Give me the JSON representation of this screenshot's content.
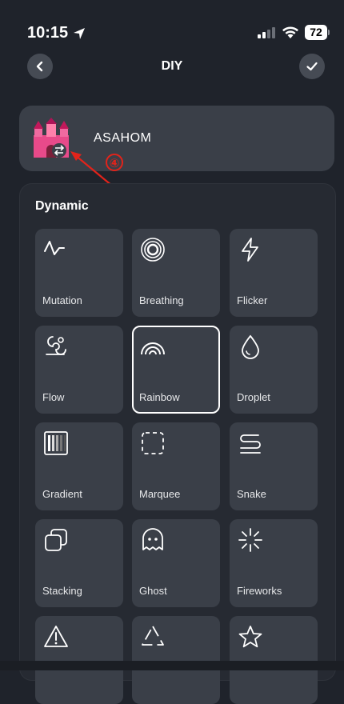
{
  "status_bar": {
    "time": "10:15",
    "battery": "72"
  },
  "header": {
    "title": "DIY"
  },
  "device": {
    "name": "ASAHOM"
  },
  "annotation": {
    "number": "④",
    "color": "#e2231a"
  },
  "section": {
    "title": "Dynamic"
  },
  "effects": [
    {
      "label": "Mutation",
      "icon": "pulse-icon"
    },
    {
      "label": "Breathing",
      "icon": "concentric-circles-icon"
    },
    {
      "label": "Flicker",
      "icon": "lightning-icon"
    },
    {
      "label": "Flow",
      "icon": "flow-swirl-icon"
    },
    {
      "label": "Rainbow",
      "icon": "rainbow-icon",
      "selected": true
    },
    {
      "label": "Droplet",
      "icon": "droplet-icon"
    },
    {
      "label": "Gradient",
      "icon": "gradient-bars-icon"
    },
    {
      "label": "Marquee",
      "icon": "dashed-square-icon"
    },
    {
      "label": "Snake",
      "icon": "snake-icon"
    },
    {
      "label": "Stacking",
      "icon": "stacked-squares-icon"
    },
    {
      "label": "Ghost",
      "icon": "ghost-icon"
    },
    {
      "label": "Fireworks",
      "icon": "fireworks-icon"
    },
    {
      "label": "",
      "icon": "warning-triangle-icon"
    },
    {
      "label": "",
      "icon": "triangle-arrows-icon"
    },
    {
      "label": "",
      "icon": "star-icon"
    }
  ],
  "colors": {
    "background": "#1f232b",
    "tile": "#3a3f48",
    "panel": "#262a32",
    "selected_border": "#ffffff"
  }
}
